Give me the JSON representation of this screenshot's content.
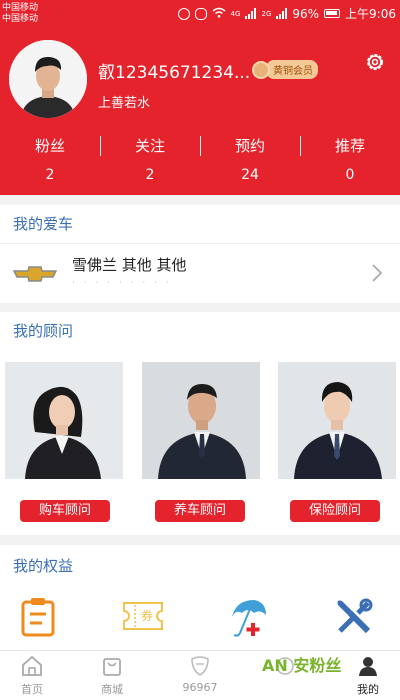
{
  "status_bar": {
    "carrier1": "中国移动",
    "carrier2": "中国移动",
    "net1": "4G",
    "net2": "2G",
    "battery": "96%",
    "time": "上午9:06"
  },
  "profile": {
    "username": "叡12345671234...",
    "badge": "黄铜会员",
    "signature": "上善若水"
  },
  "stats": [
    {
      "name": "粉丝",
      "value": "2"
    },
    {
      "name": "关注",
      "value": "2"
    },
    {
      "name": "预约",
      "value": "24"
    },
    {
      "name": "推荐",
      "value": "0"
    }
  ],
  "my_car": {
    "title": "我的爱车",
    "name": "雪佛兰 其他 其他",
    "sub": "· · · · · · · · ·"
  },
  "advisors": {
    "title": "我的顾问",
    "items": [
      {
        "label": "购车顾问"
      },
      {
        "label": "养车顾问"
      },
      {
        "label": "保险顾问"
      }
    ]
  },
  "rights": {
    "title": "我的权益",
    "coupon_text": "券"
  },
  "tabbar": [
    {
      "label": "首页"
    },
    {
      "label": "商城"
    },
    {
      "label": "96967"
    },
    {
      "label": ""
    },
    {
      "label": "我的"
    }
  ],
  "watermark": "AN 安粉丝",
  "colors": {
    "brand_red": "#e4232d",
    "section_blue": "#3a6fb3",
    "orange": "#f08a1c"
  }
}
